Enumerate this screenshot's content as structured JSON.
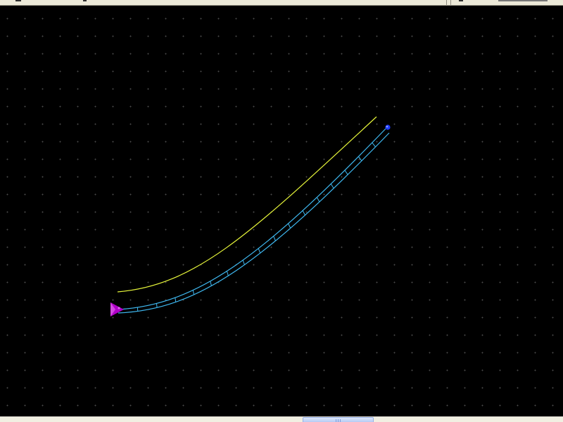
{
  "scene": {
    "background_color": "#000000",
    "grid_dot_color": "#4a4a4a",
    "guide_curve_color": "#e6f53a",
    "rail_color": "#3fb8f0",
    "start_marker_color": "#b000c8",
    "end_marker_color": "#1e3cff"
  },
  "window": {
    "chrome_color": "#ece9d8",
    "scrollbar_thumb_color": "#b4cbf4"
  }
}
